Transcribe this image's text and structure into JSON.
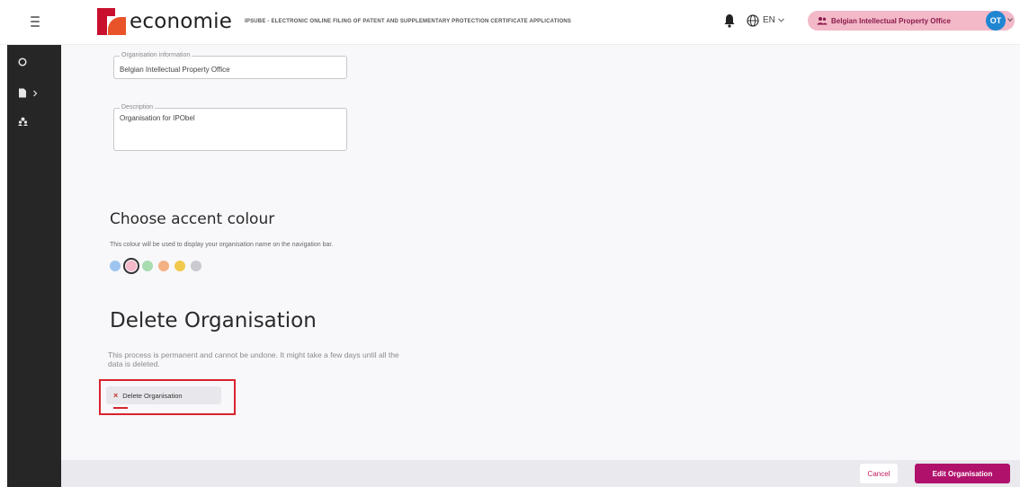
{
  "header": {
    "logo_text": "economie",
    "app_title": "IPSUBE - ELECTRONIC ONLINE FILING OF PATENT AND SUPPLEMENTARY PROTECTION CERTIFICATE APPLICATIONS",
    "language": "EN",
    "organisation": "Belgian Intellectual Property Office",
    "avatar_initials": "OT"
  },
  "form": {
    "org_info_legend": "Organisation information",
    "org_info_value": "Belgian Intellectual Property Office",
    "description_legend": "Description",
    "description_value": "Organisation for IPObel"
  },
  "accent": {
    "title": "Choose accent colour",
    "hint": "This colour will be used to display your organisation name on the navigation bar.",
    "colors": [
      "#9ec5f0",
      "#f3b9c9",
      "#a8dcb0",
      "#f4b183",
      "#f2c94c",
      "#c9c9cf"
    ],
    "selected_index": 1
  },
  "delete": {
    "title": "Delete Organisation",
    "description": "This process is permanent and cannot be undone. It might take a few days until all the data is deleted.",
    "button_label": "Delete Organisation",
    "button_icon": "close-icon"
  },
  "footer": {
    "cancel_label": "Cancel",
    "edit_label": "Edit Organisation"
  },
  "sidebar": {
    "icons": [
      "circle-icon",
      "document-icon",
      "people-icon"
    ]
  }
}
